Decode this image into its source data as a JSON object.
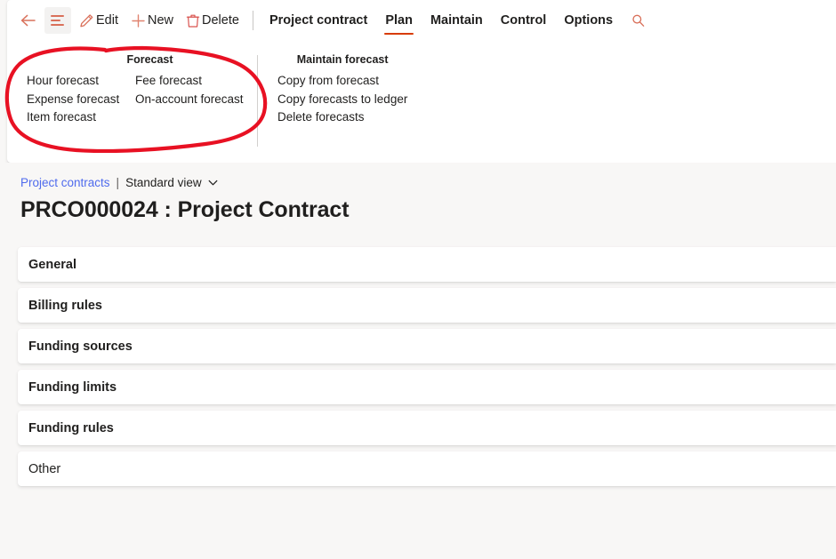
{
  "command_bar": {
    "back_icon": "back-arrow-icon",
    "hamburger_icon": "hamburger-menu-icon",
    "edit": {
      "label": "Edit",
      "icon": "pencil-icon"
    },
    "new": {
      "label": "New",
      "icon": "plus-icon"
    },
    "delete": {
      "label": "Delete",
      "icon": "trash-icon"
    },
    "tabs": [
      {
        "label": "Project contract",
        "active": false
      },
      {
        "label": "Plan",
        "active": true
      },
      {
        "label": "Maintain",
        "active": false
      },
      {
        "label": "Control",
        "active": false
      },
      {
        "label": "Options",
        "active": false
      }
    ],
    "search_icon": "search-icon"
  },
  "ribbon": {
    "groups": [
      {
        "title": "Forecast",
        "columns": [
          [
            "Hour forecast",
            "Expense forecast",
            "Item forecast"
          ],
          [
            "Fee forecast",
            "On-account forecast"
          ]
        ]
      },
      {
        "title": "Maintain forecast",
        "columns": [
          [
            "Copy from forecast",
            "Copy forecasts to ledger",
            "Delete forecasts"
          ]
        ]
      }
    ]
  },
  "annotation": {
    "shape": "hand-drawn-red-ellipse",
    "color": "#e81123",
    "target": "Forecast"
  },
  "breadcrumb": {
    "parent": "Project contracts",
    "separator": "|",
    "view": "Standard view",
    "chevron_icon": "chevron-down-icon"
  },
  "page": {
    "title": "PRCO000024 : Project Contract"
  },
  "sections": [
    {
      "label": "General",
      "bold": true
    },
    {
      "label": "Billing rules",
      "bold": true
    },
    {
      "label": "Funding sources",
      "bold": true
    },
    {
      "label": "Funding limits",
      "bold": true
    },
    {
      "label": "Funding rules",
      "bold": true
    },
    {
      "label": "Other",
      "bold": false
    }
  ],
  "colors": {
    "accent_red": "#d83b01",
    "icon_salmon": "#d9705a",
    "link_blue": "#4f6bed",
    "annotation_red": "#e81123",
    "page_background": "#f8f7f6",
    "panel_background": "#ffffff"
  }
}
